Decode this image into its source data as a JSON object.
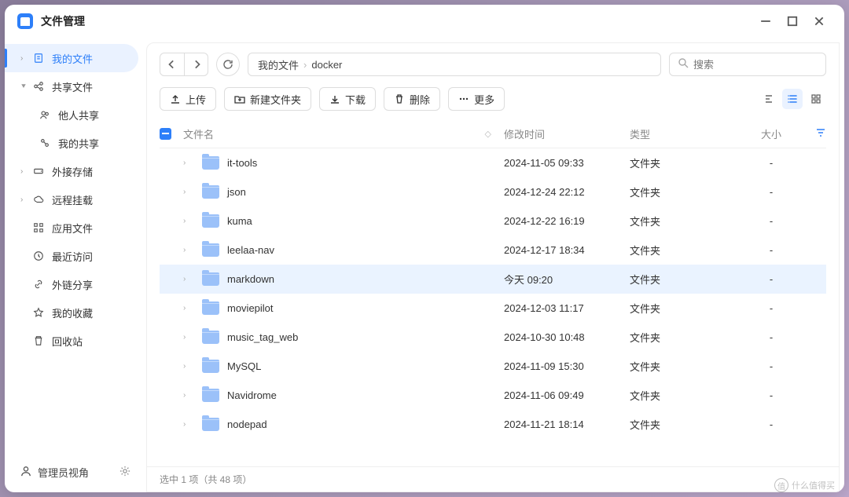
{
  "app": {
    "title": "文件管理"
  },
  "sidebar": {
    "items": [
      {
        "label": "我的文件",
        "icon": "doc",
        "active": true,
        "expandable": true
      },
      {
        "label": "共享文件",
        "icon": "share",
        "expandable": true,
        "expanded": true
      },
      {
        "label": "他人共享",
        "icon": "users",
        "sub": true
      },
      {
        "label": "我的共享",
        "icon": "share-alt",
        "sub": true
      },
      {
        "label": "外接存储",
        "icon": "hdd",
        "expandable": true
      },
      {
        "label": "远程挂载",
        "icon": "cloud",
        "expandable": true
      },
      {
        "label": "应用文件",
        "icon": "apps"
      },
      {
        "label": "最近访问",
        "icon": "clock"
      },
      {
        "label": "外链分享",
        "icon": "link"
      },
      {
        "label": "我的收藏",
        "icon": "star"
      },
      {
        "label": "回收站",
        "icon": "trash"
      }
    ],
    "footer": {
      "label": "管理员视角"
    }
  },
  "breadcrumb": {
    "root": "我的文件",
    "current": "docker"
  },
  "search": {
    "placeholder": "搜索"
  },
  "toolbar": {
    "upload": "上传",
    "newfolder": "新建文件夹",
    "download": "下载",
    "delete": "删除",
    "more": "更多"
  },
  "columns": {
    "name": "文件名",
    "mtime": "修改时间",
    "type": "类型",
    "size": "大小"
  },
  "rows": [
    {
      "name": "it-tools",
      "mtime": "2024-11-05 09:33",
      "type": "文件夹",
      "size": "-"
    },
    {
      "name": "json",
      "mtime": "2024-12-24 22:12",
      "type": "文件夹",
      "size": "-"
    },
    {
      "name": "kuma",
      "mtime": "2024-12-22 16:19",
      "type": "文件夹",
      "size": "-"
    },
    {
      "name": "leelaa-nav",
      "mtime": "2024-12-17 18:34",
      "type": "文件夹",
      "size": "-"
    },
    {
      "name": "markdown",
      "mtime": "今天 09:20",
      "type": "文件夹",
      "size": "-",
      "selected": true
    },
    {
      "name": "moviepilot",
      "mtime": "2024-12-03 11:17",
      "type": "文件夹",
      "size": "-"
    },
    {
      "name": "music_tag_web",
      "mtime": "2024-10-30 10:48",
      "type": "文件夹",
      "size": "-"
    },
    {
      "name": "MySQL",
      "mtime": "2024-11-09 15:30",
      "type": "文件夹",
      "size": "-"
    },
    {
      "name": "Navidrome",
      "mtime": "2024-11-06 09:49",
      "type": "文件夹",
      "size": "-"
    },
    {
      "name": "nodepad",
      "mtime": "2024-11-21 18:14",
      "type": "文件夹",
      "size": "-"
    }
  ],
  "status": {
    "text": "选中 1 项（共 48 项）"
  },
  "watermark": "什么值得买"
}
